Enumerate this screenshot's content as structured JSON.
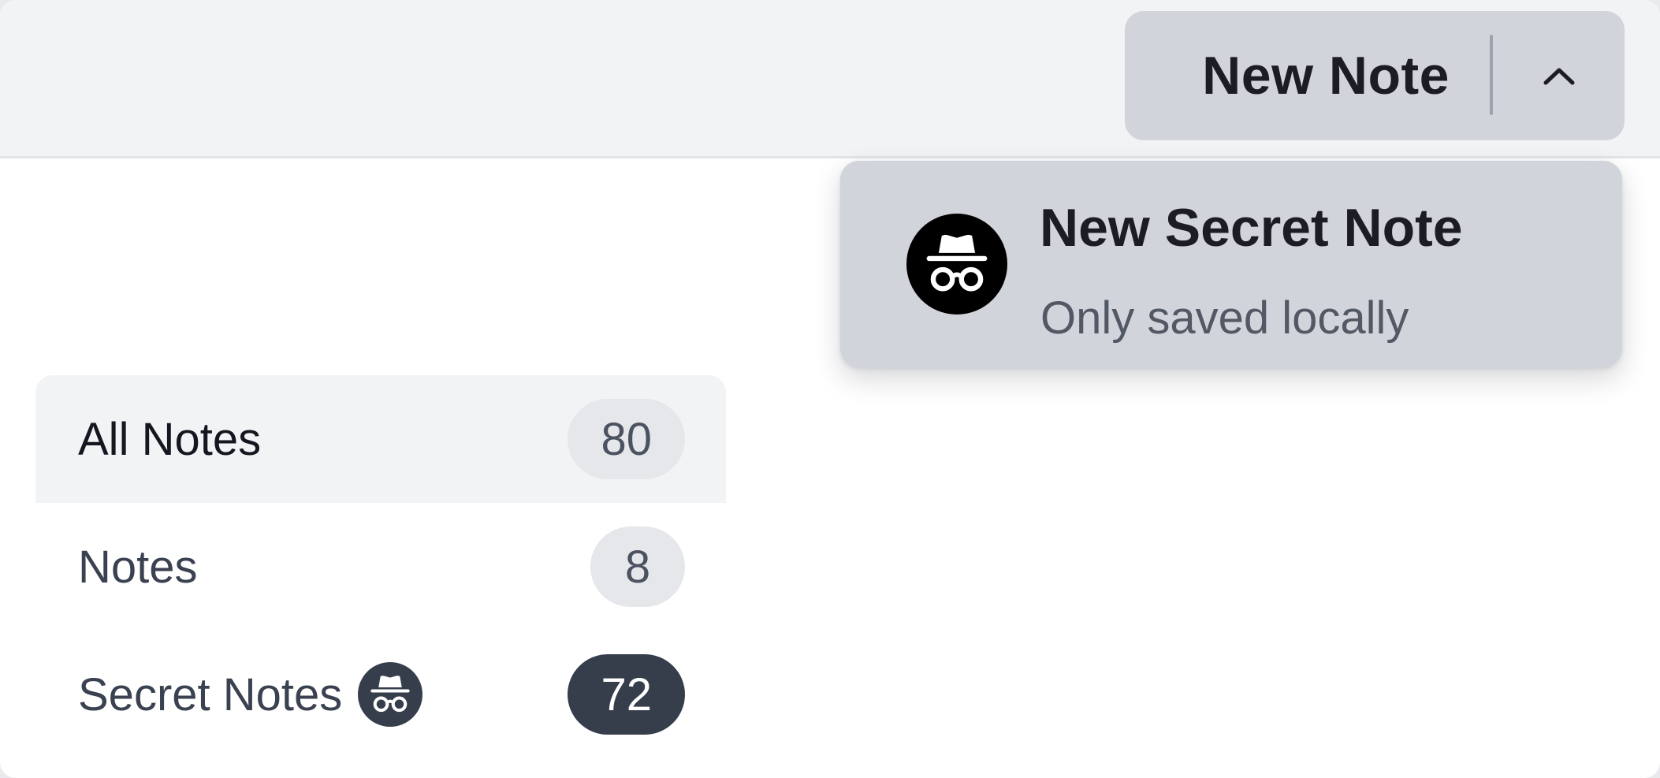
{
  "toolbar": {
    "new_note_button": {
      "label": "New Note",
      "toggle_icon": "chevron-up-icon"
    }
  },
  "new_note_menu": {
    "items": [
      {
        "icon": "incognito-icon",
        "title": "New Secret Note",
        "subtitle": "Only saved locally"
      }
    ]
  },
  "sidebar": {
    "items": [
      {
        "label": "All Notes",
        "count": "80",
        "active": true
      },
      {
        "label": "Notes",
        "count": "8",
        "active": false
      },
      {
        "label": "Secret Notes",
        "count": "72",
        "active": false,
        "icon": "incognito-icon"
      }
    ]
  },
  "colors": {
    "toolbar_background": "#f2f3f5",
    "button_background": "#d2d4dc",
    "badge_background": "#e6e7eb",
    "dark_badge_background": "#363d4b",
    "text_primary": "#1b1d22",
    "text_secondary": "#525864"
  }
}
